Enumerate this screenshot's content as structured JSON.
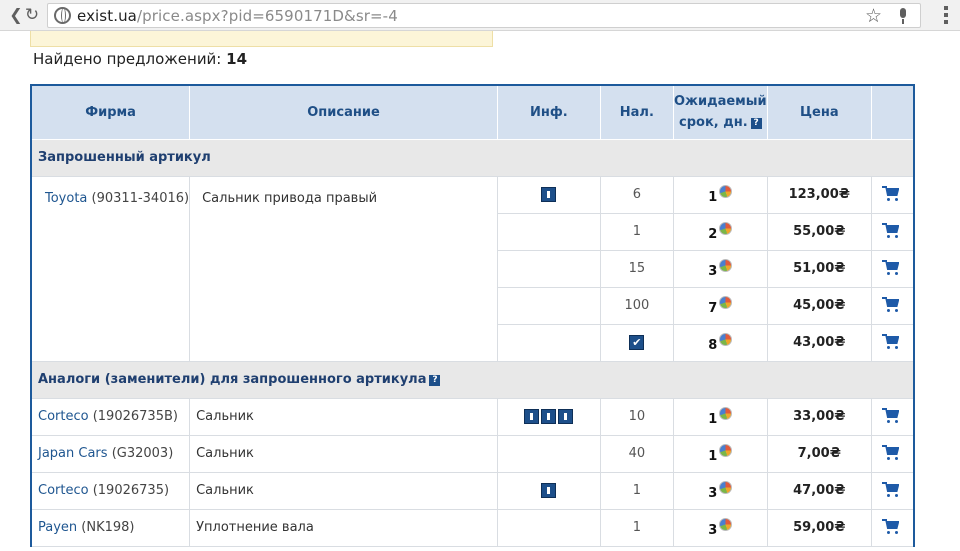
{
  "browser": {
    "url_host": "exist.ua",
    "url_path": "/price.aspx?pid=6590171D&sr=-4"
  },
  "summary": {
    "found_label": "Найдено предложений:",
    "found_count": "14"
  },
  "table": {
    "headers": {
      "firm": "Фирма",
      "description": "Описание",
      "info": "Инф.",
      "availability": "Нал.",
      "term_line1": "Ожидаемый",
      "term_line2": "срок, дн.",
      "price": "Цена"
    },
    "requested_section": "Запрошенный артикул",
    "requested": {
      "brand": "Toyota",
      "code": "(90311-34016)",
      "description": "Сальник привода правый",
      "offers": [
        {
          "qty": "6",
          "term": "1",
          "price": "123,00₴"
        },
        {
          "qty": "1",
          "term": "2",
          "price": "55,00₴"
        },
        {
          "qty": "15",
          "term": "3",
          "price": "51,00₴"
        },
        {
          "qty": "100",
          "term": "7",
          "price": "45,00₴"
        },
        {
          "qty": "",
          "term": "8",
          "price": "43,00₴"
        }
      ]
    },
    "analogs_section": "Аналоги (заменители) для запрошенного артикула",
    "analogs": [
      {
        "brand": "Corteco",
        "code": "(19026735B)",
        "description": "Сальник",
        "qty": "10",
        "term": "1",
        "price": "33,00₴"
      },
      {
        "brand": "Japan Cars",
        "code": "(G32003)",
        "description": "Сальник",
        "qty": "40",
        "term": "1",
        "price": "7,00₴"
      },
      {
        "brand": "Corteco",
        "code": "(19026735)",
        "description": "Сальник",
        "qty": "1",
        "term": "3",
        "price": "47,00₴"
      },
      {
        "brand": "Payen",
        "code": "(NK198)",
        "description": "Уплотнение вала",
        "qty": "1",
        "term": "3",
        "price": "59,00₴"
      }
    ]
  },
  "icons": {
    "help": "?",
    "check": "✔"
  }
}
